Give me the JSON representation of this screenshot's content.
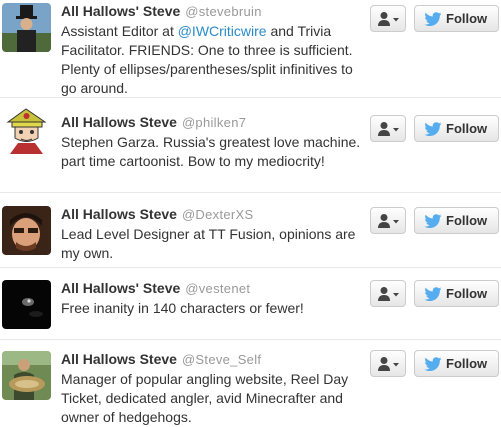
{
  "users": [
    {
      "name": "All Hallows' Steve",
      "handle": "@stevebruin",
      "bio_parts": [
        "Assistant Editor at ",
        "@IWCriticwire",
        " and Trivia Facilitator. FRIENDS: One to three is sufficient. Plenty of ellipses/parentheses/split infinitives to go around."
      ],
      "follow_label": "Follow",
      "avatar_icon": "lincoln-portrait-avatar"
    },
    {
      "name": "All Hallows Steve",
      "handle": "@philken7",
      "bio": "Stephen Garza. Russia's greatest love machine. part time cartoonist. Bow to my mediocrity!",
      "follow_label": "Follow",
      "avatar_icon": "cartoon-cap-avatar"
    },
    {
      "name": "All Hallows Steve",
      "handle": "@DexterXS",
      "bio": "Lead Level Designer at TT Fusion, opinions are my own.",
      "follow_label": "Follow",
      "avatar_icon": "face-photo-avatar"
    },
    {
      "name": "All Hallows' Steve",
      "handle": "@vestenet",
      "bio": "Free inanity in 140 characters or fewer!",
      "follow_label": "Follow",
      "avatar_icon": "dark-photo-avatar"
    },
    {
      "name": "All Hallows Steve",
      "handle": "@Steve_Self",
      "bio": "Manager of popular angling website, Reel Day Ticket, dedicated angler, avid Minecrafter and owner of hedgehogs.",
      "follow_label": "Follow",
      "avatar_icon": "angler-fish-avatar"
    }
  ],
  "colors": {
    "mention": "#2a8cc8",
    "twitter_bird": "#55acee",
    "handle": "#999999",
    "divider": "#e8e8e8"
  },
  "icons": {
    "user_action": "user-dropdown-icon",
    "follow": "twitter-bird-icon"
  }
}
